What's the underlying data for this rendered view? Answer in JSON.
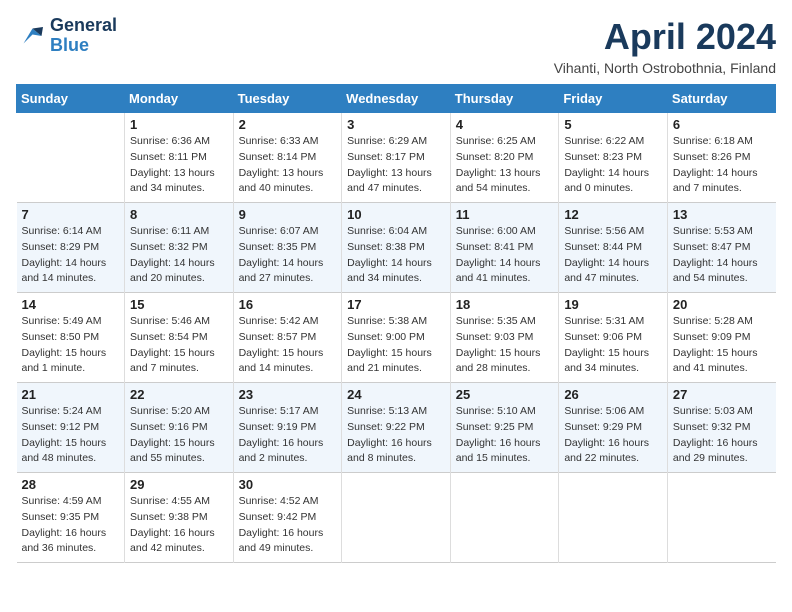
{
  "header": {
    "logo_line1": "General",
    "logo_line2": "Blue",
    "month": "April 2024",
    "location": "Vihanti, North Ostrobothnia, Finland"
  },
  "days_of_week": [
    "Sunday",
    "Monday",
    "Tuesday",
    "Wednesday",
    "Thursday",
    "Friday",
    "Saturday"
  ],
  "weeks": [
    [
      {
        "day": "",
        "info": ""
      },
      {
        "day": "1",
        "info": "Sunrise: 6:36 AM\nSunset: 8:11 PM\nDaylight: 13 hours\nand 34 minutes."
      },
      {
        "day": "2",
        "info": "Sunrise: 6:33 AM\nSunset: 8:14 PM\nDaylight: 13 hours\nand 40 minutes."
      },
      {
        "day": "3",
        "info": "Sunrise: 6:29 AM\nSunset: 8:17 PM\nDaylight: 13 hours\nand 47 minutes."
      },
      {
        "day": "4",
        "info": "Sunrise: 6:25 AM\nSunset: 8:20 PM\nDaylight: 13 hours\nand 54 minutes."
      },
      {
        "day": "5",
        "info": "Sunrise: 6:22 AM\nSunset: 8:23 PM\nDaylight: 14 hours\nand 0 minutes."
      },
      {
        "day": "6",
        "info": "Sunrise: 6:18 AM\nSunset: 8:26 PM\nDaylight: 14 hours\nand 7 minutes."
      }
    ],
    [
      {
        "day": "7",
        "info": "Sunrise: 6:14 AM\nSunset: 8:29 PM\nDaylight: 14 hours\nand 14 minutes."
      },
      {
        "day": "8",
        "info": "Sunrise: 6:11 AM\nSunset: 8:32 PM\nDaylight: 14 hours\nand 20 minutes."
      },
      {
        "day": "9",
        "info": "Sunrise: 6:07 AM\nSunset: 8:35 PM\nDaylight: 14 hours\nand 27 minutes."
      },
      {
        "day": "10",
        "info": "Sunrise: 6:04 AM\nSunset: 8:38 PM\nDaylight: 14 hours\nand 34 minutes."
      },
      {
        "day": "11",
        "info": "Sunrise: 6:00 AM\nSunset: 8:41 PM\nDaylight: 14 hours\nand 41 minutes."
      },
      {
        "day": "12",
        "info": "Sunrise: 5:56 AM\nSunset: 8:44 PM\nDaylight: 14 hours\nand 47 minutes."
      },
      {
        "day": "13",
        "info": "Sunrise: 5:53 AM\nSunset: 8:47 PM\nDaylight: 14 hours\nand 54 minutes."
      }
    ],
    [
      {
        "day": "14",
        "info": "Sunrise: 5:49 AM\nSunset: 8:50 PM\nDaylight: 15 hours\nand 1 minute."
      },
      {
        "day": "15",
        "info": "Sunrise: 5:46 AM\nSunset: 8:54 PM\nDaylight: 15 hours\nand 7 minutes."
      },
      {
        "day": "16",
        "info": "Sunrise: 5:42 AM\nSunset: 8:57 PM\nDaylight: 15 hours\nand 14 minutes."
      },
      {
        "day": "17",
        "info": "Sunrise: 5:38 AM\nSunset: 9:00 PM\nDaylight: 15 hours\nand 21 minutes."
      },
      {
        "day": "18",
        "info": "Sunrise: 5:35 AM\nSunset: 9:03 PM\nDaylight: 15 hours\nand 28 minutes."
      },
      {
        "day": "19",
        "info": "Sunrise: 5:31 AM\nSunset: 9:06 PM\nDaylight: 15 hours\nand 34 minutes."
      },
      {
        "day": "20",
        "info": "Sunrise: 5:28 AM\nSunset: 9:09 PM\nDaylight: 15 hours\nand 41 minutes."
      }
    ],
    [
      {
        "day": "21",
        "info": "Sunrise: 5:24 AM\nSunset: 9:12 PM\nDaylight: 15 hours\nand 48 minutes."
      },
      {
        "day": "22",
        "info": "Sunrise: 5:20 AM\nSunset: 9:16 PM\nDaylight: 15 hours\nand 55 minutes."
      },
      {
        "day": "23",
        "info": "Sunrise: 5:17 AM\nSunset: 9:19 PM\nDaylight: 16 hours\nand 2 minutes."
      },
      {
        "day": "24",
        "info": "Sunrise: 5:13 AM\nSunset: 9:22 PM\nDaylight: 16 hours\nand 8 minutes."
      },
      {
        "day": "25",
        "info": "Sunrise: 5:10 AM\nSunset: 9:25 PM\nDaylight: 16 hours\nand 15 minutes."
      },
      {
        "day": "26",
        "info": "Sunrise: 5:06 AM\nSunset: 9:29 PM\nDaylight: 16 hours\nand 22 minutes."
      },
      {
        "day": "27",
        "info": "Sunrise: 5:03 AM\nSunset: 9:32 PM\nDaylight: 16 hours\nand 29 minutes."
      }
    ],
    [
      {
        "day": "28",
        "info": "Sunrise: 4:59 AM\nSunset: 9:35 PM\nDaylight: 16 hours\nand 36 minutes."
      },
      {
        "day": "29",
        "info": "Sunrise: 4:55 AM\nSunset: 9:38 PM\nDaylight: 16 hours\nand 42 minutes."
      },
      {
        "day": "30",
        "info": "Sunrise: 4:52 AM\nSunset: 9:42 PM\nDaylight: 16 hours\nand 49 minutes."
      },
      {
        "day": "",
        "info": ""
      },
      {
        "day": "",
        "info": ""
      },
      {
        "day": "",
        "info": ""
      },
      {
        "day": "",
        "info": ""
      }
    ]
  ]
}
